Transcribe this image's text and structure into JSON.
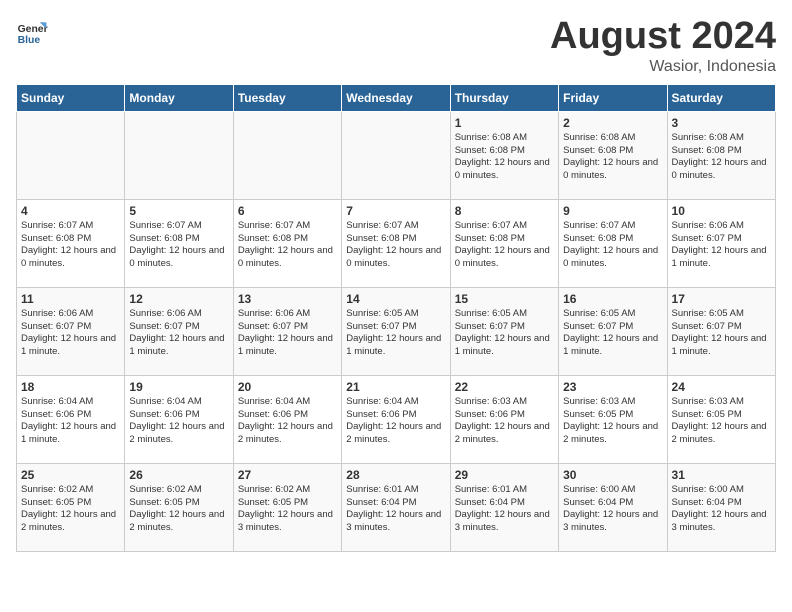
{
  "logo": {
    "line1": "General",
    "line2": "Blue"
  },
  "calendar": {
    "title": "August 2024",
    "subtitle": "Wasior, Indonesia"
  },
  "headers": [
    "Sunday",
    "Monday",
    "Tuesday",
    "Wednesday",
    "Thursday",
    "Friday",
    "Saturday"
  ],
  "weeks": [
    [
      {
        "day": "",
        "info": ""
      },
      {
        "day": "",
        "info": ""
      },
      {
        "day": "",
        "info": ""
      },
      {
        "day": "",
        "info": ""
      },
      {
        "day": "1",
        "info": "Sunrise: 6:08 AM\nSunset: 6:08 PM\nDaylight: 12 hours\nand 0 minutes."
      },
      {
        "day": "2",
        "info": "Sunrise: 6:08 AM\nSunset: 6:08 PM\nDaylight: 12 hours\nand 0 minutes."
      },
      {
        "day": "3",
        "info": "Sunrise: 6:08 AM\nSunset: 6:08 PM\nDaylight: 12 hours\nand 0 minutes."
      }
    ],
    [
      {
        "day": "4",
        "info": "Sunrise: 6:07 AM\nSunset: 6:08 PM\nDaylight: 12 hours\nand 0 minutes."
      },
      {
        "day": "5",
        "info": "Sunrise: 6:07 AM\nSunset: 6:08 PM\nDaylight: 12 hours\nand 0 minutes."
      },
      {
        "day": "6",
        "info": "Sunrise: 6:07 AM\nSunset: 6:08 PM\nDaylight: 12 hours\nand 0 minutes."
      },
      {
        "day": "7",
        "info": "Sunrise: 6:07 AM\nSunset: 6:08 PM\nDaylight: 12 hours\nand 0 minutes."
      },
      {
        "day": "8",
        "info": "Sunrise: 6:07 AM\nSunset: 6:08 PM\nDaylight: 12 hours\nand 0 minutes."
      },
      {
        "day": "9",
        "info": "Sunrise: 6:07 AM\nSunset: 6:08 PM\nDaylight: 12 hours\nand 0 minutes."
      },
      {
        "day": "10",
        "info": "Sunrise: 6:06 AM\nSunset: 6:07 PM\nDaylight: 12 hours\nand 1 minute."
      }
    ],
    [
      {
        "day": "11",
        "info": "Sunrise: 6:06 AM\nSunset: 6:07 PM\nDaylight: 12 hours\nand 1 minute."
      },
      {
        "day": "12",
        "info": "Sunrise: 6:06 AM\nSunset: 6:07 PM\nDaylight: 12 hours\nand 1 minute."
      },
      {
        "day": "13",
        "info": "Sunrise: 6:06 AM\nSunset: 6:07 PM\nDaylight: 12 hours\nand 1 minute."
      },
      {
        "day": "14",
        "info": "Sunrise: 6:05 AM\nSunset: 6:07 PM\nDaylight: 12 hours\nand 1 minute."
      },
      {
        "day": "15",
        "info": "Sunrise: 6:05 AM\nSunset: 6:07 PM\nDaylight: 12 hours\nand 1 minute."
      },
      {
        "day": "16",
        "info": "Sunrise: 6:05 AM\nSunset: 6:07 PM\nDaylight: 12 hours\nand 1 minute."
      },
      {
        "day": "17",
        "info": "Sunrise: 6:05 AM\nSunset: 6:07 PM\nDaylight: 12 hours\nand 1 minute."
      }
    ],
    [
      {
        "day": "18",
        "info": "Sunrise: 6:04 AM\nSunset: 6:06 PM\nDaylight: 12 hours\nand 1 minute."
      },
      {
        "day": "19",
        "info": "Sunrise: 6:04 AM\nSunset: 6:06 PM\nDaylight: 12 hours\nand 2 minutes."
      },
      {
        "day": "20",
        "info": "Sunrise: 6:04 AM\nSunset: 6:06 PM\nDaylight: 12 hours\nand 2 minutes."
      },
      {
        "day": "21",
        "info": "Sunrise: 6:04 AM\nSunset: 6:06 PM\nDaylight: 12 hours\nand 2 minutes."
      },
      {
        "day": "22",
        "info": "Sunrise: 6:03 AM\nSunset: 6:06 PM\nDaylight: 12 hours\nand 2 minutes."
      },
      {
        "day": "23",
        "info": "Sunrise: 6:03 AM\nSunset: 6:05 PM\nDaylight: 12 hours\nand 2 minutes."
      },
      {
        "day": "24",
        "info": "Sunrise: 6:03 AM\nSunset: 6:05 PM\nDaylight: 12 hours\nand 2 minutes."
      }
    ],
    [
      {
        "day": "25",
        "info": "Sunrise: 6:02 AM\nSunset: 6:05 PM\nDaylight: 12 hours\nand 2 minutes."
      },
      {
        "day": "26",
        "info": "Sunrise: 6:02 AM\nSunset: 6:05 PM\nDaylight: 12 hours\nand 2 minutes."
      },
      {
        "day": "27",
        "info": "Sunrise: 6:02 AM\nSunset: 6:05 PM\nDaylight: 12 hours\nand 3 minutes."
      },
      {
        "day": "28",
        "info": "Sunrise: 6:01 AM\nSunset: 6:04 PM\nDaylight: 12 hours\nand 3 minutes."
      },
      {
        "day": "29",
        "info": "Sunrise: 6:01 AM\nSunset: 6:04 PM\nDaylight: 12 hours\nand 3 minutes."
      },
      {
        "day": "30",
        "info": "Sunrise: 6:00 AM\nSunset: 6:04 PM\nDaylight: 12 hours\nand 3 minutes."
      },
      {
        "day": "31",
        "info": "Sunrise: 6:00 AM\nSunset: 6:04 PM\nDaylight: 12 hours\nand 3 minutes."
      }
    ]
  ]
}
